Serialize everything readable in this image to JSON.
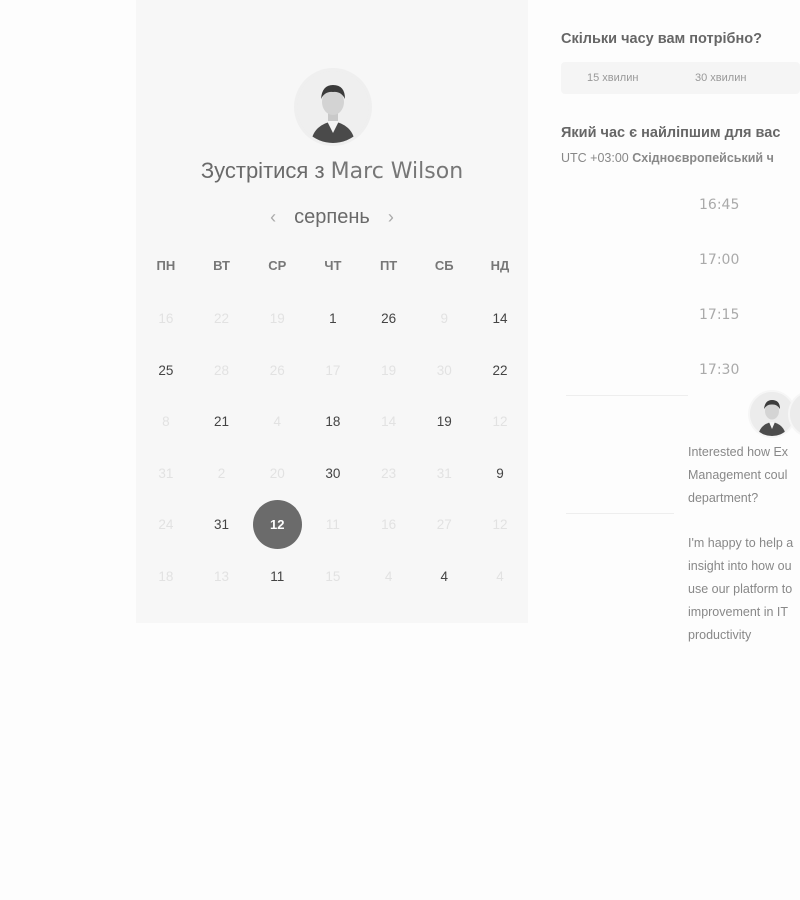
{
  "calendar": {
    "title_prefix": "Зустрітися з ",
    "host_name": "Marc Wilson",
    "month": "серпень",
    "prev_icon": "‹",
    "next_icon": "›",
    "weekdays": [
      "ПН",
      "ВТ",
      "СР",
      "ЧТ",
      "ПТ",
      "СБ",
      "НД"
    ],
    "weeks": [
      [
        {
          "d": "16",
          "a": false
        },
        {
          "d": "22",
          "a": false
        },
        {
          "d": "19",
          "a": false
        },
        {
          "d": "1",
          "a": true
        },
        {
          "d": "26",
          "a": true
        },
        {
          "d": "9",
          "a": false
        },
        {
          "d": "14",
          "a": true
        }
      ],
      [
        {
          "d": "25",
          "a": true
        },
        {
          "d": "28",
          "a": false
        },
        {
          "d": "26",
          "a": false
        },
        {
          "d": "17",
          "a": false
        },
        {
          "d": "19",
          "a": false
        },
        {
          "d": "30",
          "a": false
        },
        {
          "d": "22",
          "a": true
        }
      ],
      [
        {
          "d": "8",
          "a": false
        },
        {
          "d": "21",
          "a": true
        },
        {
          "d": "4",
          "a": false
        },
        {
          "d": "18",
          "a": true
        },
        {
          "d": "14",
          "a": false
        },
        {
          "d": "19",
          "a": true
        },
        {
          "d": "12",
          "a": false
        }
      ],
      [
        {
          "d": "31",
          "a": false
        },
        {
          "d": "2",
          "a": false
        },
        {
          "d": "20",
          "a": false
        },
        {
          "d": "30",
          "a": true
        },
        {
          "d": "23",
          "a": false
        },
        {
          "d": "31",
          "a": false
        },
        {
          "d": "9",
          "a": true
        }
      ],
      [
        {
          "d": "24",
          "a": false
        },
        {
          "d": "31",
          "a": true
        },
        {
          "d": "12",
          "a": true,
          "selected": true
        },
        {
          "d": "11",
          "a": false
        },
        {
          "d": "16",
          "a": false
        },
        {
          "d": "27",
          "a": false
        },
        {
          "d": "12",
          "a": false
        }
      ],
      [
        {
          "d": "18",
          "a": false
        },
        {
          "d": "13",
          "a": false
        },
        {
          "d": "11",
          "a": true
        },
        {
          "d": "15",
          "a": false
        },
        {
          "d": "4",
          "a": false
        },
        {
          "d": "4",
          "a": true
        },
        {
          "d": "4",
          "a": false
        }
      ]
    ]
  },
  "booking": {
    "duration_question": "Скільки часу вам потрібно?",
    "durations": [
      "15 хвилин",
      "30 хвилин"
    ],
    "time_question": "Який час є найліпшим для вас",
    "tz_offset": "UTC +03:00",
    "tz_name": "Східноєвропейський ч",
    "slots": [
      "16:45",
      "17:00",
      "17:15",
      "17:30"
    ]
  },
  "chat": {
    "message_1": [
      "Interested how Ex",
      "Management coul",
      "department?"
    ],
    "message_2": [
      "I'm happy to help a",
      "insight into how ou",
      "use our platform to",
      "improvement in IT",
      "productivity"
    ]
  },
  "colors": {
    "card_bg": "#f7f7f7",
    "selected_day": "#6b6b6b",
    "active_day_text": "#444444",
    "inactive_day_text": "#e2e2e2"
  }
}
